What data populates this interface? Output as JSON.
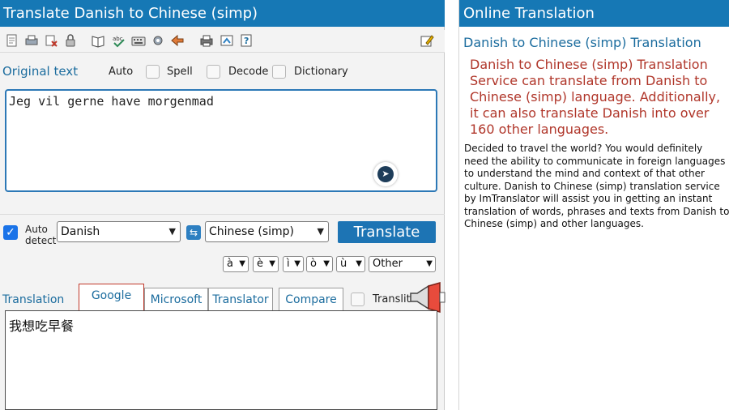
{
  "left": {
    "title": "Translate Danish to Chinese (simp)",
    "original_label": "Original text",
    "options": {
      "auto": "Auto",
      "spell": "Spell",
      "decode": "Decode",
      "dictionary": "Dictionary"
    },
    "source_text": "Jeg vil gerne have morgenmad",
    "auto_detect": "Auto\ndetect",
    "auto_detect_line1": "Auto",
    "auto_detect_line2": "detect",
    "from_lang": "Danish",
    "to_lang": "Chinese (simp)",
    "translate_button": "Translate",
    "accents": [
      "à",
      "è",
      "ì",
      "ò",
      "ù"
    ],
    "accent_other": "Other",
    "tabs": {
      "translation": "Translation",
      "google": "Google",
      "microsoft": "Microsoft",
      "translator": "Translator",
      "compare": "Compare",
      "translit": "Translit"
    },
    "result_text": "我想吃早餐"
  },
  "right": {
    "title": "Online Translation",
    "subtitle": "Danish to Chinese (simp) Translation",
    "description": "Danish to Chinese (simp) Translation Service can translate from Danish to Chinese (simp) language. Additionally, it can also translate Danish into over 160 other languages.",
    "body": "Decided to travel the world? You would definitely need the ability to communicate in foreign languages to understand the mind and context of that other culture. Danish to Chinese (simp) translation service by ImTranslator will assist you in getting an instant translation of words, phrases and texts from Danish to Chinese (simp) and other languages."
  },
  "colors": {
    "brand_blue": "#1678b5",
    "accent_red": "#b0362a",
    "link_blue": "#1b6c9e"
  },
  "icons": [
    "document-icon",
    "print-icon",
    "clear-icon",
    "lock-icon",
    "dictionary-icon",
    "spell-check-icon",
    "keyboard-icon",
    "settings-icon",
    "back-icon",
    "printer-icon",
    "share-icon",
    "help-icon",
    "edit-icon"
  ]
}
